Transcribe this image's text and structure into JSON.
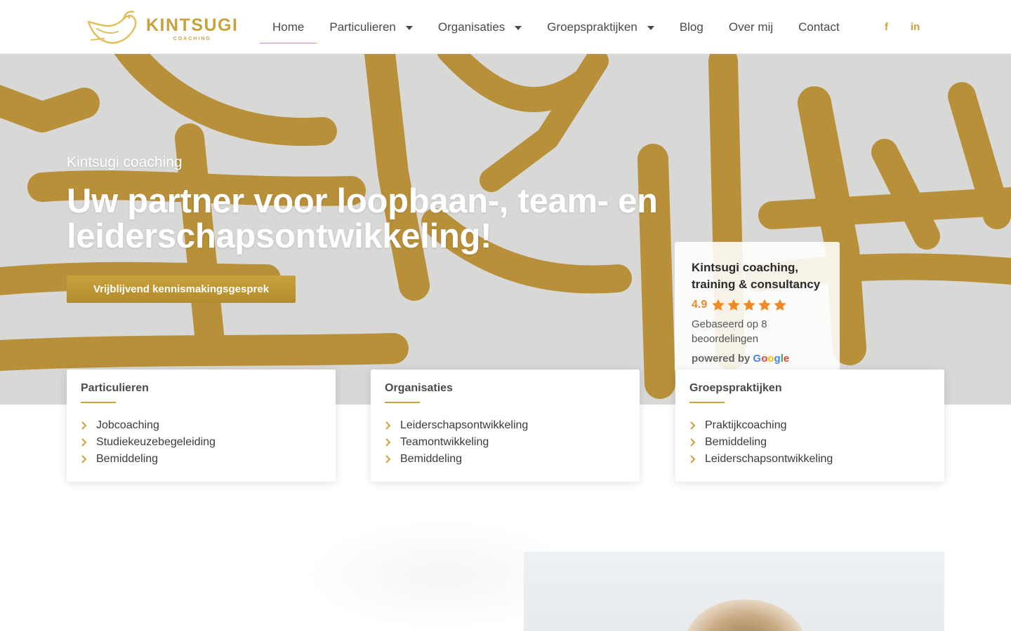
{
  "header": {
    "logo": {
      "name": "KINTSUGI",
      "sub": "COACHING"
    },
    "nav": [
      {
        "label": "Home",
        "active": true,
        "dropdown": false
      },
      {
        "label": "Particulieren",
        "active": false,
        "dropdown": true
      },
      {
        "label": "Organisaties",
        "active": false,
        "dropdown": true
      },
      {
        "label": "Groepspraktijken",
        "active": false,
        "dropdown": true
      },
      {
        "label": "Blog",
        "active": false,
        "dropdown": false
      },
      {
        "label": "Over mij",
        "active": false,
        "dropdown": false
      },
      {
        "label": "Contact",
        "active": false,
        "dropdown": false
      }
    ],
    "social": {
      "facebook": "f",
      "linkedin": "in"
    }
  },
  "hero": {
    "eyebrow": "Kintsugi coaching",
    "title": "Uw partner voor loopbaan-, team- en leiderschapsontwikkeling!",
    "cta": "Vrijblijvend kennismakingsgesprek"
  },
  "review": {
    "name": "Kintsugi coaching, training & consultancy",
    "score": "4.9",
    "stars": 5,
    "based_on": "Gebaseerd op 8 beoordelingen",
    "powered_by": "powered by",
    "google": [
      "G",
      "o",
      "o",
      "g",
      "l",
      "e"
    ]
  },
  "cards": [
    {
      "title": "Particulieren",
      "items": [
        "Jobcoaching",
        "Studiekeuzebegeleiding",
        "Bemiddeling"
      ]
    },
    {
      "title": "Organisaties",
      "items": [
        "Leiderschapsontwikkeling",
        "Teamontwikkeling",
        "Bemiddeling"
      ]
    },
    {
      "title": "Groepspraktijken",
      "items": [
        "Praktijkcoaching",
        "Bemiddeling",
        "Leiderschapsontwikkeling"
      ]
    }
  ],
  "colors": {
    "accent": "#c9a23e",
    "hero_bg": "#d6d6d4",
    "stroke": "#b8903a",
    "star": "#f08a24"
  },
  "icons": {
    "logo": "bird-icon",
    "caret": "caret-down-icon",
    "facebook": "facebook-icon",
    "linkedin": "linkedin-icon",
    "chevron": "chevron-right-icon",
    "star": "star-icon"
  }
}
